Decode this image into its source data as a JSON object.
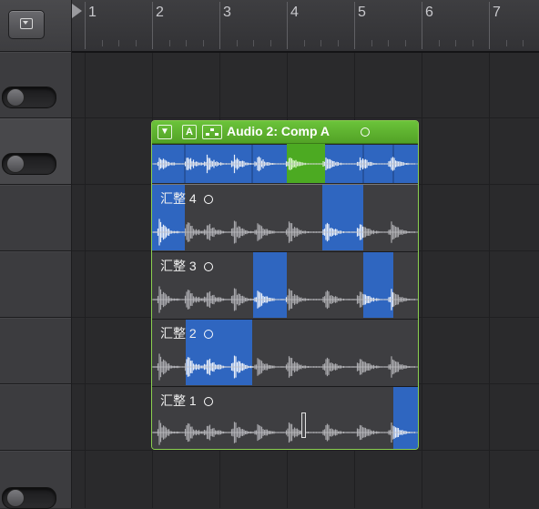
{
  "ruler": {
    "bars": [
      "1",
      "2",
      "3",
      "4",
      "5",
      "6",
      "7"
    ]
  },
  "region": {
    "header": {
      "collapse_glyph": "▼",
      "a_label": "A",
      "quick_swipe_icon": "grid-dots-icon",
      "title": "Audio 2: Comp A"
    },
    "takes": [
      {
        "label": "汇整 4"
      },
      {
        "label": "汇整 3"
      },
      {
        "label": "汇整 2"
      },
      {
        "label": "汇整 1"
      }
    ]
  },
  "colors": {
    "comp_header": "#5cb32e",
    "selection_blue": "#2f66c0",
    "waveform_grey": "#a8a8ac",
    "waveform_white": "#e8eef8"
  }
}
